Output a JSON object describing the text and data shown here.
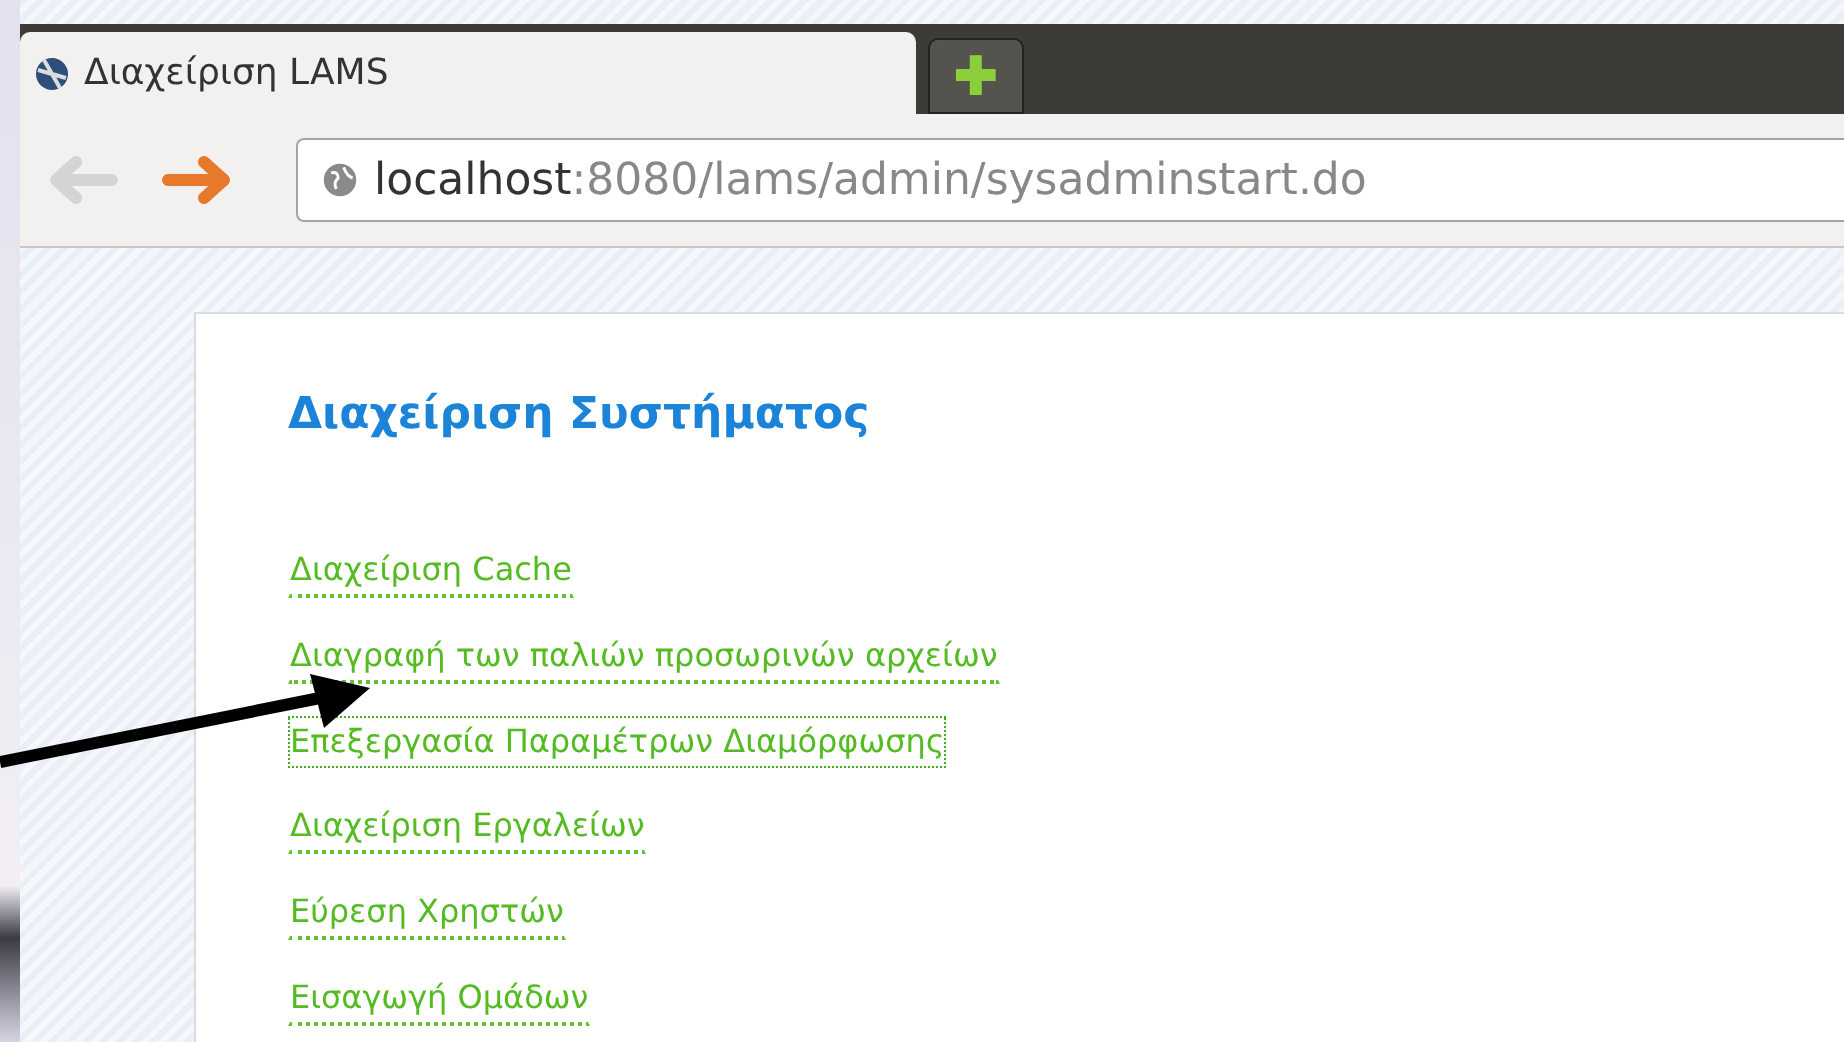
{
  "tab": {
    "title": "Διαχείριση LAMS",
    "selected": true
  },
  "new_tab": {
    "label": "✚"
  },
  "toolbar": {
    "back": {
      "disabled": true
    },
    "forward": {
      "disabled": false
    }
  },
  "address_bar": {
    "host": "localhost",
    "path": ":8080/lams/admin/sysadminstart.do"
  },
  "page": {
    "heading": "Διαχείριση Συστήματος",
    "links": [
      {
        "label": "Διαχείριση Cache",
        "focused": false
      },
      {
        "label": "Διαγραφή των παλιών προσωρινών αρχείων",
        "focused": false
      },
      {
        "label": "Επεξεργασία Παραμέτρων Διαμόρφωσης",
        "focused": true
      },
      {
        "label": "Διαχείριση Εργαλείων",
        "focused": false
      },
      {
        "label": "Εύρεση Χρηστών",
        "focused": false
      },
      {
        "label": "Εισαγωγή Ομάδων",
        "focused": false
      }
    ]
  }
}
